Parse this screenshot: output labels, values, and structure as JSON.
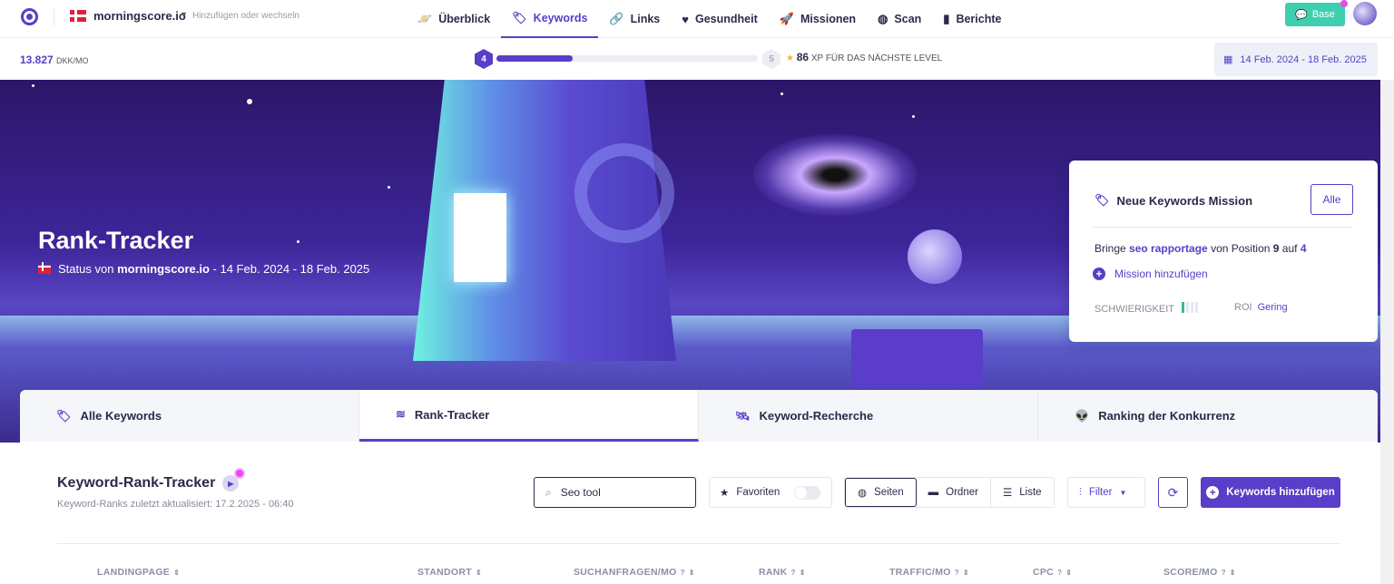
{
  "header": {
    "site": "morningscore.io",
    "switch_hint": "Hinzufügen oder wechseln",
    "nav": [
      {
        "label": "Überblick",
        "icon": "planet-icon"
      },
      {
        "label": "Keywords",
        "icon": "tag-icon",
        "active": true
      },
      {
        "label": "Links",
        "icon": "link-icon"
      },
      {
        "label": "Gesundheit",
        "icon": "heart-icon"
      },
      {
        "label": "Missionen",
        "icon": "rocket-icon"
      },
      {
        "label": "Scan",
        "icon": "globe-icon"
      },
      {
        "label": "Berichte",
        "icon": "document-icon"
      }
    ],
    "base_label": "Base"
  },
  "subbar": {
    "value": "13.827",
    "unit": "DKK/MO",
    "level_current": "4",
    "level_next": "5",
    "progress": 0.29,
    "xp": "86",
    "xp_label": "XP FÜR DAS NÄCHSTE LEVEL",
    "date_range": "14 Feb. 2024 - 18 Feb. 2025"
  },
  "hero": {
    "title": "Rank-Tracker",
    "status_prefix": "Status von",
    "status_site": "morningscore.io",
    "status_range": " - 14 Feb. 2024 - 18 Feb. 2025"
  },
  "mission": {
    "title": "Neue Keywords Mission",
    "all_label": "Alle",
    "line": {
      "p1": "Bringe ",
      "keyword": "seo rapportage",
      "p2": " von Position ",
      "from": "9",
      "p3": " auf ",
      "to": "4"
    },
    "add_label": "Mission hinzufügen",
    "difficulty_label": "SCHWIERIGKEIT",
    "difficulty_level": 1,
    "difficulty_max": 4,
    "roi_label": "ROI",
    "roi_value": "Gering"
  },
  "tabs": [
    {
      "label": "Alle Keywords",
      "icon": "tag-icon"
    },
    {
      "label": "Rank-Tracker",
      "icon": "layers-icon",
      "active": true
    },
    {
      "label": "Keyword-Recherche",
      "icon": "satellite-icon"
    },
    {
      "label": "Ranking der Konkurrenz",
      "icon": "alien-icon"
    }
  ],
  "main": {
    "title": "Keyword-Rank-Tracker",
    "updated": "Keyword-Ranks zuletzt aktualisiert: 17.2.2025 - 06:40",
    "search_value": "Seo tool",
    "favorites_label": "Favoriten",
    "views": [
      "Seiten",
      "Ordner",
      "Liste"
    ],
    "filter_label": "Filter",
    "add_keywords_label": "Keywords hinzufügen",
    "columns": [
      "LANDINGPAGE",
      "STANDORT",
      "SUCHANFRAGEN/MO",
      "RANK",
      "TRAFFIC/MO",
      "CPC",
      "SCORE/MO"
    ]
  },
  "colors": {
    "accent": "#5a3dc8",
    "base_button": "#3ecfb0"
  }
}
